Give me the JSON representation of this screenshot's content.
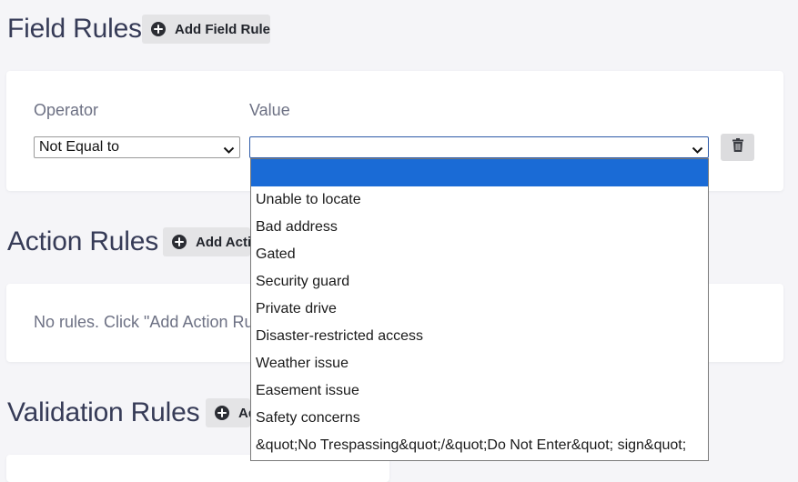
{
  "field_rules": {
    "title": "Field Rules",
    "add_label": "Add Field Rule",
    "operator_label": "Operator",
    "value_label": "Value",
    "operator_selected": "Not Equal to",
    "value_selected": ""
  },
  "action_rules": {
    "title": "Action Rules",
    "add_label": "Add Action Rule",
    "empty_text": "No rules. Click \"Add Action Rule\""
  },
  "validation_rules": {
    "title": "Validation Rules",
    "add_label": "Add Validation Rule"
  },
  "value_dropdown": {
    "options": [
      "",
      "Unable to locate",
      "Bad address",
      "Gated",
      "Security guard",
      "Private drive",
      "Disaster-restricted access",
      "Weather issue",
      "Easement issue",
      "Safety concerns",
      "&quot;No Trespassing&quot;/&quot;Do Not Enter&quot; sign&quot;"
    ],
    "selected_index": 0
  },
  "colors": {
    "background": "#f5f5f8",
    "heading": "#363b57",
    "muted_label": "#6d7184",
    "button_bg": "#e4e4e6",
    "selected_option_bg": "#1a6bd6",
    "focus_border": "#2d5aa8"
  },
  "icons": {
    "add": "plus-circle-icon",
    "delete": "trash-icon",
    "select_arrow": "chevron-down-icon"
  }
}
